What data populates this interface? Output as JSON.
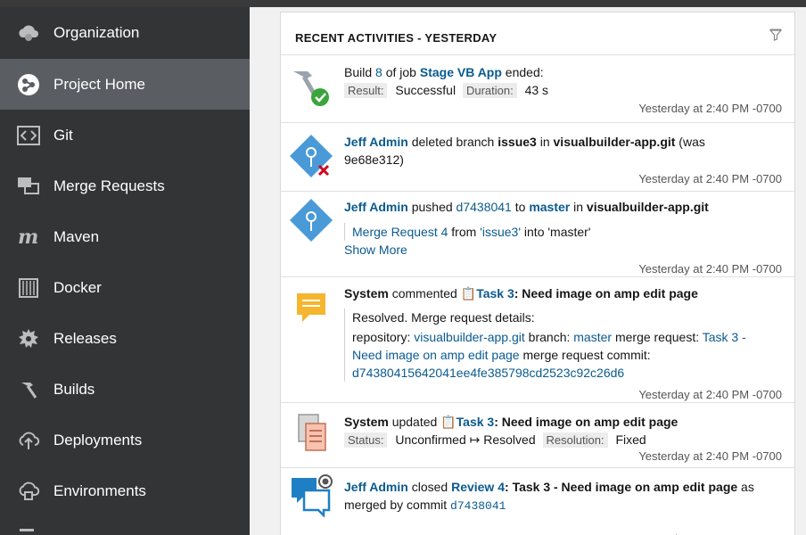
{
  "sidebar": {
    "items": [
      {
        "label": "Organization",
        "icon": "cloud-icon"
      },
      {
        "label": "Project Home",
        "icon": "project-home-icon"
      },
      {
        "label": "Git",
        "icon": "git-icon"
      },
      {
        "label": "Merge Requests",
        "icon": "merge-requests-icon"
      },
      {
        "label": "Maven",
        "icon": "maven-icon"
      },
      {
        "label": "Docker",
        "icon": "docker-icon"
      },
      {
        "label": "Releases",
        "icon": "releases-icon"
      },
      {
        "label": "Builds",
        "icon": "hammer-icon"
      },
      {
        "label": "Deployments",
        "icon": "deploy-icon"
      },
      {
        "label": "Environments",
        "icon": "environments-icon"
      }
    ],
    "active": "Project Home"
  },
  "panel": {
    "title": "RECENT ACTIVITIES - YESTERDAY",
    "timestamp": "Yesterday at 2:40 PM -0700"
  },
  "activities": {
    "build": {
      "pre": "Build ",
      "number": "8",
      "mid": " of job ",
      "job": "Stage VB App",
      "post": " ended:",
      "result_label": "Result:",
      "result_value": "Successful",
      "duration_label": "Duration:",
      "duration_value": "43 s"
    },
    "delete": {
      "user": "Jeff Admin",
      "verb": " deleted branch ",
      "branch": "issue3",
      "in": " in ",
      "repo": "visualbuilder-app.git",
      "was": " (was",
      "hash": "9e68e312)"
    },
    "push": {
      "user": "Jeff Admin",
      "verb": " pushed ",
      "commit": "d7438041",
      "to": " to ",
      "branch": "master",
      "in": " in ",
      "repo": "visualbuilder-app.git",
      "mr": "Merge Request 4",
      "from": " from ",
      "source": "'issue3'",
      "into": " into 'master'",
      "show_more": "Show More"
    },
    "comment": {
      "user": "System",
      "verb": " commented ",
      "task": "Task 3",
      "task_title": ": Need image on amp edit page",
      "line1": "Resolved. Merge request details:",
      "repo_label": "repository: ",
      "repo": "visualbuilder-app.git",
      "branch_label": " branch: ",
      "branch": "master",
      "mr_label": " merge request: ",
      "mr_a": "Task 3 -",
      "mr_b": "Need image on amp edit page",
      "commit_label": " merge request commit:",
      "commit": "d74380415642041ee4fe385798cd2523c92c26d6"
    },
    "update": {
      "user": "System",
      "verb": " updated ",
      "task": "Task 3",
      "task_title": ": Need image on amp edit page",
      "status_label": "Status:",
      "status_value": "Unconfirmed ↦ Resolved",
      "resolution_label": "Resolution:",
      "resolution_value": "Fixed"
    },
    "review": {
      "user": "Jeff Admin",
      "verb": " closed ",
      "review": "Review 4",
      "title": ": Task 3 - Need image on amp edit page",
      "as": " as",
      "line2": "merged by commit ",
      "commit": "d7438041"
    }
  },
  "colors": {
    "sidebar_bg": "#333436",
    "sidebar_active": "#5a5d61",
    "link": "#0a5a8f",
    "success": "#3aa53a",
    "error": "#d0021b",
    "git_blue": "#4a9ad8",
    "comment_yellow": "#f5b52e"
  }
}
